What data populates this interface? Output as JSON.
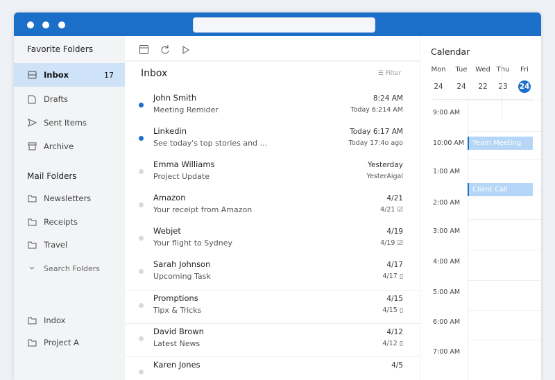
{
  "sidebar": {
    "favorites_heading": "Favorite Folders",
    "favorites": [
      {
        "label": "Inbox",
        "count": "17",
        "icon": "inbox-icon"
      },
      {
        "label": "Drafts",
        "icon": "draft-icon"
      },
      {
        "label": "Sent Items",
        "icon": "send-icon"
      },
      {
        "label": "Archive",
        "icon": "archive-icon"
      }
    ],
    "mail_heading": "Mail Folders",
    "folders": [
      {
        "label": "Newsletters"
      },
      {
        "label": "Receipts"
      },
      {
        "label": "Travel"
      }
    ],
    "search_folders": "Search Folders",
    "bottom": [
      {
        "label": "Indox"
      },
      {
        "label": "Project A"
      }
    ]
  },
  "list": {
    "title": "Inbox",
    "filter": "Filter",
    "messages": [
      {
        "sender": "John Smith",
        "subject": "Meeting Remider",
        "time": "8:24 AM",
        "sub_time": "Today 6:214 AM",
        "unread": true
      },
      {
        "sender": "Linkedin",
        "subject": "See today's top stories and ...",
        "time": "Today 6:17 AM",
        "sub_time": "Today 17:4o ago",
        "unread": true
      },
      {
        "sender": "Emma Williams",
        "subject": "Project Update",
        "time": "Yesterday",
        "sub_time": "YesterAigal",
        "unread": false
      },
      {
        "sender": "Amazon",
        "subject": "Your receipt from Amazon",
        "time": "4/21",
        "sub_time": "4/21 ☑",
        "unread": false
      },
      {
        "sender": "Webjet",
        "subject": "Your flight to Sydney",
        "time": "4/19",
        "sub_time": "4/19 ☑",
        "unread": false
      },
      {
        "sender": "Sarah Johnson",
        "subject": "Upcoming Task",
        "time": "4/17",
        "sub_time": "4/17 ▯",
        "unread": false
      },
      {
        "sender": "Promptions",
        "subject": "Tipx & Tricks",
        "time": "4/15",
        "sub_time": "4/15 ▯",
        "unread": false
      },
      {
        "sender": "David Brown",
        "subject": "Latest News",
        "time": "4/12",
        "sub_time": "4/12 ▯",
        "unread": false
      },
      {
        "sender": "Karen Jones",
        "subject": "",
        "time": "4/5",
        "sub_time": "",
        "unread": false
      }
    ]
  },
  "calendar": {
    "title": "Calendar",
    "days": [
      {
        "name": "Mon",
        "num": "24"
      },
      {
        "name": "Tue",
        "num": "24"
      },
      {
        "name": "Wed",
        "num": "22"
      },
      {
        "name": "Thu",
        "num": "23"
      },
      {
        "name": "Fri",
        "num": "24",
        "today": true
      }
    ],
    "times": [
      "9:00 AM",
      "10:00 AM",
      "1:00 AM",
      "2:00 AM",
      "3:00 AM",
      "4:00 AM",
      "5:00 AM",
      "6:00 AM",
      "7:00 AM"
    ],
    "events": [
      {
        "title": "Yeam Meeting"
      },
      {
        "title": "Client Call"
      }
    ]
  },
  "colors": {
    "accent": "#1b6fc8",
    "unread_dot": "#1b6fc8",
    "read_dot": "#d9d9d9"
  }
}
